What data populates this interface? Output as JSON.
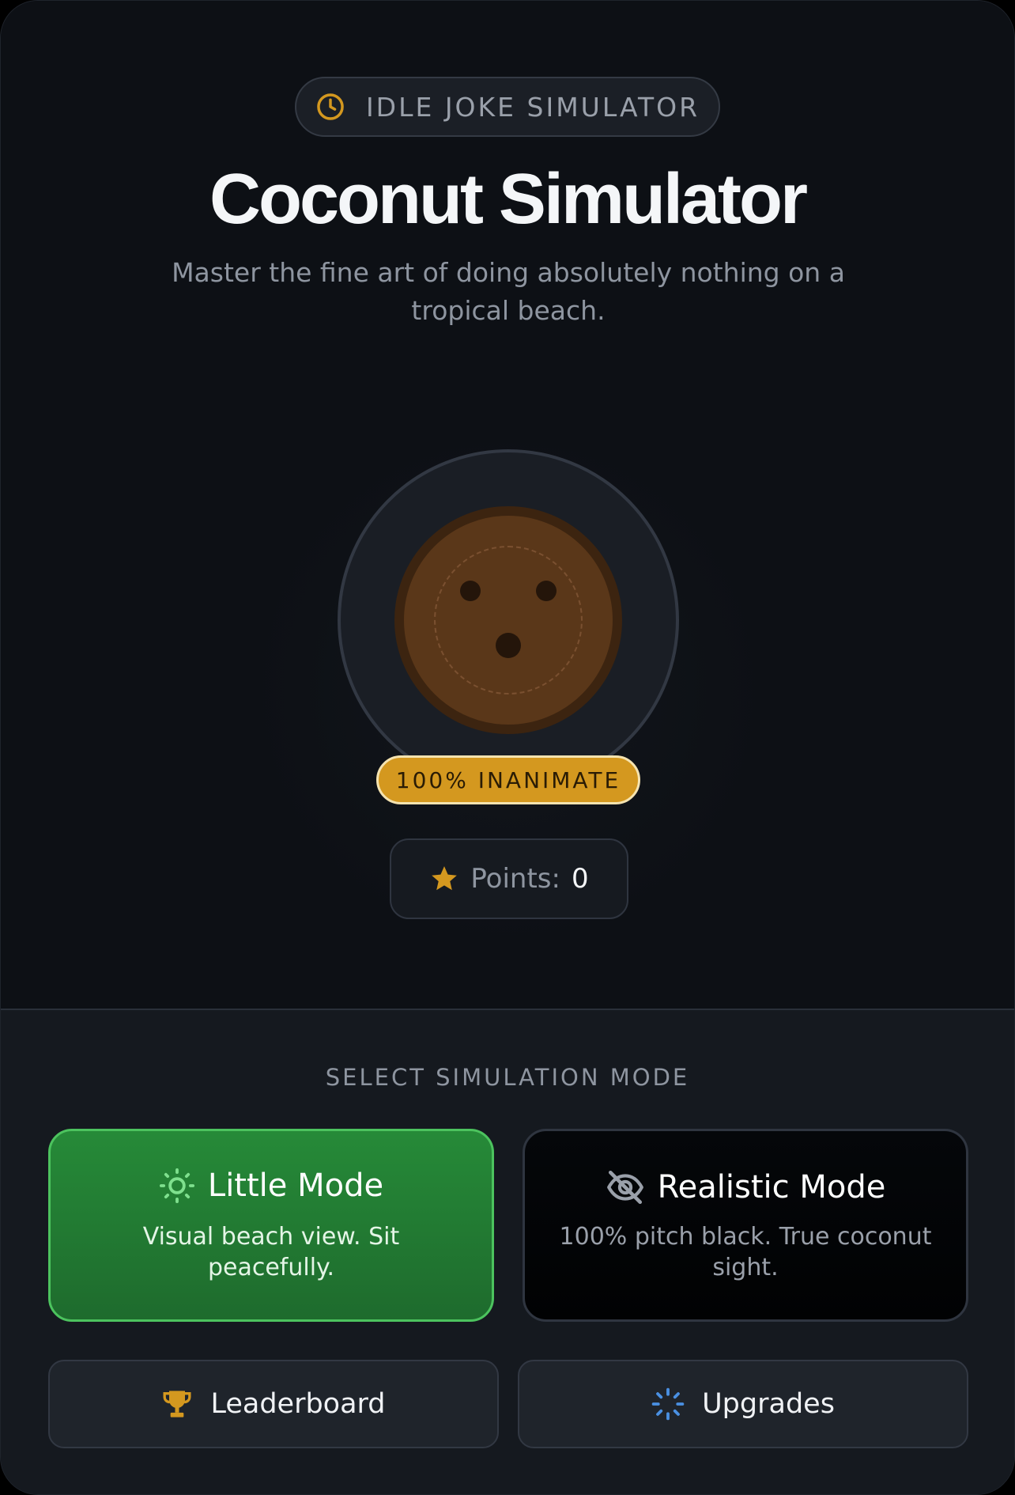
{
  "header": {
    "pill_icon": "clock-icon",
    "pill_label": "IDLE JOKE SIMULATOR",
    "title": "Coconut Simulator",
    "subtitle": "Master the fine art of doing absolutely nothing on a tropical beach."
  },
  "coconut": {
    "status_badge": "100% INANIMATE"
  },
  "points": {
    "icon": "star-icon",
    "label": "Points:",
    "value": "0"
  },
  "modes": {
    "section_label": "SELECT SIMULATION MODE",
    "items": [
      {
        "icon": "sun-icon",
        "title": "Little Mode",
        "description": "Visual beach view. Sit peacefully.",
        "selected": true
      },
      {
        "icon": "eye-off-icon",
        "title": "Realistic Mode",
        "description": "100% pitch black. True coconut sight.",
        "selected": false
      }
    ]
  },
  "actions": [
    {
      "icon": "trophy-icon",
      "label": "Leaderboard"
    },
    {
      "icon": "loader-icon",
      "label": "Upgrades"
    }
  ],
  "colors": {
    "background": "#0d1015",
    "accent_gold": "#d4981f",
    "selected_green": "#268a38",
    "upgrades_blue": "#4a90e2"
  }
}
